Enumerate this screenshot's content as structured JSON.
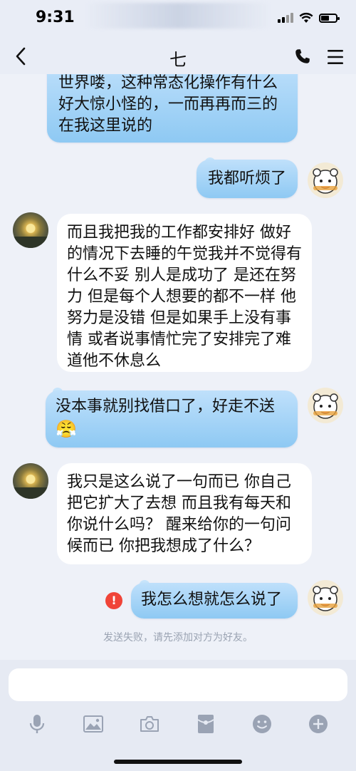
{
  "status_bar": {
    "time": "9:31"
  },
  "nav": {
    "title": "七"
  },
  "messages": [
    {
      "side": "right",
      "text": "台就不干，大不了就不卖房坏游世界喽，这种常态化操作有什么好大惊小怪的，一而再再而三的在我这里说的"
    },
    {
      "side": "right",
      "text": "我都听烦了"
    },
    {
      "side": "left",
      "text": "而且我把我的工作都安排好 做好的情况下去睡的午觉我并不觉得有什么不妥  别人是成功了 是还在努力 但是每个人想要的都不一样 他努力是没错  但是如果手上没有事情 或者说事情忙完了安排完了难道他不休息么"
    },
    {
      "side": "right",
      "text": "没本事就别找借口了，好走不送",
      "emoji": "😤"
    },
    {
      "side": "left",
      "text": "我只是这么说了一句而已 你自己把它扩大了去想 而且我有每天和你说什么吗？  醒来给你的一句问候而已  你把我想成了什么？"
    },
    {
      "side": "right",
      "text": "我怎么想就怎么说了",
      "failed": true
    }
  ],
  "fail_icon": "!",
  "fail_note": "发送失败，请先添加对方为好友。",
  "input": {
    "placeholder": ""
  },
  "colors": {
    "bubble_blue": "#8ec9f3",
    "background": "#eef1f8",
    "fail_red": "#f04438"
  },
  "icons": [
    "back-icon",
    "phone-icon",
    "menu-icon",
    "microphone-icon",
    "image-icon",
    "camera-icon",
    "red-packet-icon",
    "emoji-icon",
    "plus-icon"
  ]
}
